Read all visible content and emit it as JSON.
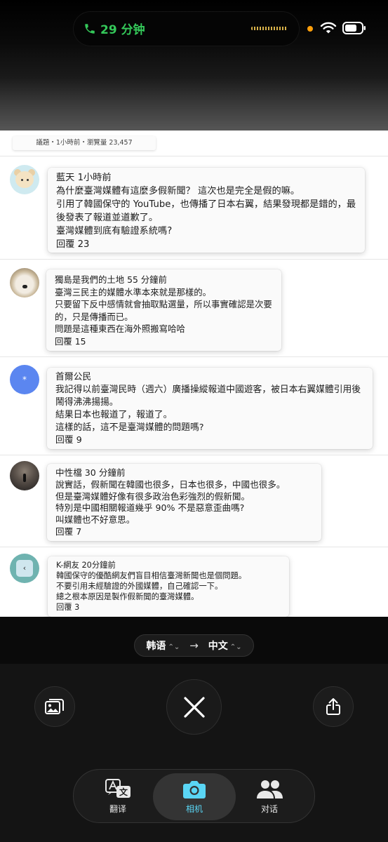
{
  "status": {
    "call_duration": "29 分钟",
    "colors": {
      "call": "#34c759",
      "privacy_dot": "#ff9f0a"
    }
  },
  "doc": {
    "meta": "議題・1小時前・瀏覽量 23,457",
    "comments": [
      {
        "avatar": "bear-avatar",
        "lines": [
          "藍天 1小時前",
          "為什麼臺灣媒體有這麼多假新聞？ 這次也是完全是假的嘛。",
          "引用了韓國保守的 YouTube，也傳播了日本右翼，結果發現都是錯的，最後發表了報道並道歉了。",
          "臺灣媒體到底有驗證系統嗎?",
          "回覆 23"
        ]
      },
      {
        "avatar": "dog-avatar",
        "lines": [
          "獨島是我們的土地 55 分鐘前",
          "臺灣三民主的媒體水準本來就是那樣的。",
          "只要留下反中感情就會抽取點選量，所以事實確認是次要的，只是傳播而已。",
          "問題是這種東西在海外照搬寫哈哈",
          "回覆 15"
        ]
      },
      {
        "avatar": "asterisk-avatar",
        "avatar_text": "*",
        "lines": [
          "首爾公民",
          "我記得以前臺灣民時（週六）廣播操縱報道中國遊客，被日本右翼媒體引用後鬧得沸沸揚揚。",
          "結果日本也報道了，報道了。",
          "這樣的話，這不是臺灣媒體的問題嗎?",
          "回覆 9"
        ]
      },
      {
        "avatar": "silhouette-avatar",
        "lines": [
          "中性檔 30 分鐘前",
          "說實話，假新聞在韓國也很多，日本也很多，中國也很多。",
          "但是臺灣媒體好像有很多政治色彩強烈的假新聞。",
          "特別是中國相關報道幾乎 90% 不是惡意歪曲嗎?",
          "叫媒體也不好意思。",
          "回覆 7"
        ]
      },
      {
        "avatar": "teal-avatar",
        "avatar_text": "‹",
        "lines": [
          "K-網友 20分鐘前",
          "韓國保守的優酷網友們盲目相信臺灣新聞也是個問題。",
          "不要引用未經驗證的外國媒體，自己確認一下。",
          "總之根本原因是製作假新聞的臺灣媒體。",
          "回覆 3"
        ]
      }
    ]
  },
  "translate": {
    "source_lang": "韩语",
    "target_lang": "中文",
    "arrow": "→"
  },
  "tabs": [
    {
      "label": "翻译",
      "icon": "translate-icon",
      "active": false
    },
    {
      "label": "相机",
      "icon": "camera-icon",
      "active": true
    },
    {
      "label": "对话",
      "icon": "people-icon",
      "active": false
    }
  ],
  "colors": {
    "active_tab": "#5ad6f5"
  }
}
